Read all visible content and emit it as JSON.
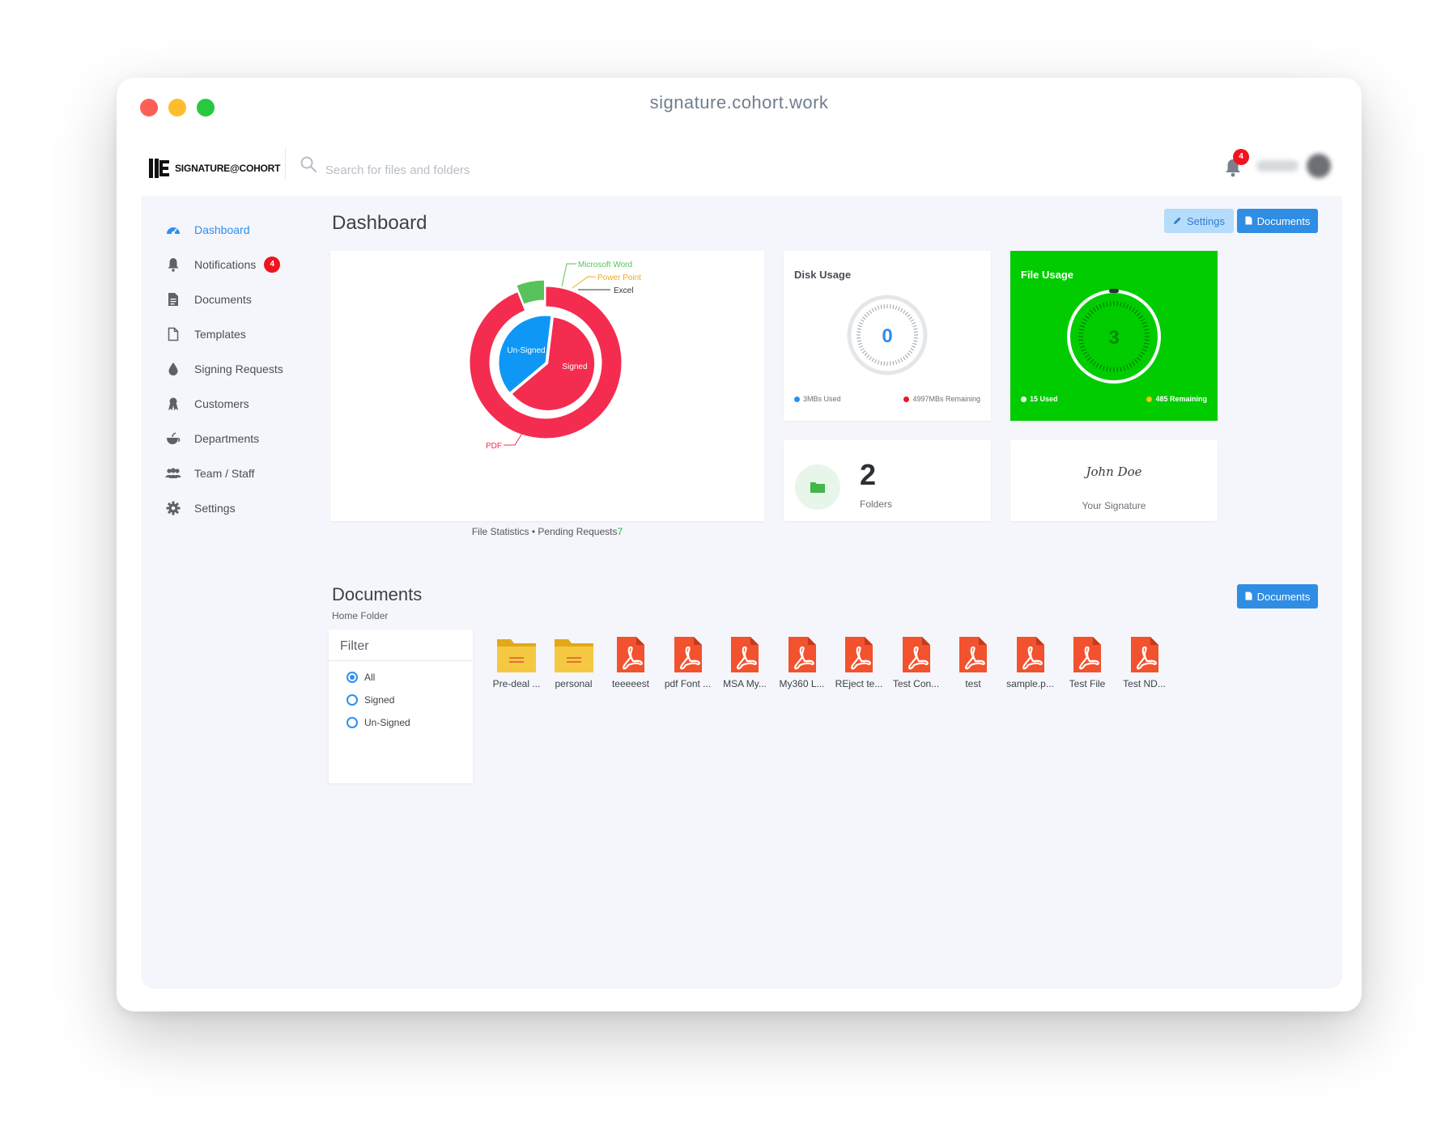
{
  "browser": {
    "url": "signature.cohort.work"
  },
  "brand": {
    "logo_text": "SIGNATURE@COHORT"
  },
  "search": {
    "placeholder": "Search for files and folders"
  },
  "header": {
    "notification_count": "4"
  },
  "sidebar": {
    "items": [
      {
        "label": "Dashboard",
        "icon": "dashboard-icon",
        "active": true
      },
      {
        "label": "Notifications",
        "icon": "bell-icon",
        "badge": "4"
      },
      {
        "label": "Documents",
        "icon": "document-icon"
      },
      {
        "label": "Templates",
        "icon": "template-icon"
      },
      {
        "label": "Signing Requests",
        "icon": "drop-icon"
      },
      {
        "label": "Customers",
        "icon": "customer-icon"
      },
      {
        "label": "Departments",
        "icon": "department-icon"
      },
      {
        "label": "Team / Staff",
        "icon": "team-icon"
      },
      {
        "label": "Settings",
        "icon": "gear-icon"
      }
    ]
  },
  "dashboard": {
    "title": "Dashboard",
    "settings_label": "Settings",
    "documents_label": "Documents"
  },
  "chart_data": {
    "type": "pie",
    "outer_ring": [
      {
        "label": "PDF",
        "value": 94,
        "color": "#f42c50"
      },
      {
        "label": "Microsoft Word",
        "value": 6,
        "color": "#58c35b"
      },
      {
        "label": "Power Point",
        "value": 0,
        "color": "#f5a623"
      },
      {
        "label": "Excel",
        "value": 0,
        "color": "#333333"
      }
    ],
    "inner_pie": [
      {
        "label": "Un-Signed",
        "value": 38,
        "color": "#0f97f5"
      },
      {
        "label": "Signed",
        "value": 62,
        "color": "#f42c50"
      }
    ]
  },
  "file_stats": {
    "caption": "File Statistics • Pending Requests",
    "pending_count": "7"
  },
  "disk_usage": {
    "title": "Disk Usage",
    "value": "0",
    "used": "3MBs Used",
    "remaining": "4997MBs Remaining",
    "used_color": "#2e8ff0",
    "remaining_color": "#f0141e"
  },
  "file_usage": {
    "title": "File Usage",
    "value": "3",
    "used": "15 Used",
    "remaining": "485 Remaining",
    "card_color": "#00cc00",
    "used_color": "#ffffff",
    "remaining_color": "#f5c400"
  },
  "folders": {
    "count": "2",
    "label": "Folders"
  },
  "signature": {
    "name": "John Doe",
    "label": "Your Signature"
  },
  "documents": {
    "title": "Documents",
    "subtitle": "Home Folder",
    "button_label": "Documents",
    "filter_title": "Filter",
    "filter_options": [
      {
        "label": "All",
        "checked": true
      },
      {
        "label": "Signed",
        "checked": false
      },
      {
        "label": "Un-Signed",
        "checked": false
      }
    ],
    "items": [
      {
        "type": "folder",
        "name": "Pre-deal ..."
      },
      {
        "type": "folder",
        "name": "personal"
      },
      {
        "type": "pdf",
        "name": "teeeeest"
      },
      {
        "type": "pdf",
        "name": "pdf Font ..."
      },
      {
        "type": "pdf",
        "name": "MSA My..."
      },
      {
        "type": "pdf",
        "name": "My360 L..."
      },
      {
        "type": "pdf",
        "name": "REject te..."
      },
      {
        "type": "pdf",
        "name": "Test Con..."
      },
      {
        "type": "pdf",
        "name": "test"
      },
      {
        "type": "pdf",
        "name": "sample.p..."
      },
      {
        "type": "pdf",
        "name": "Test File"
      },
      {
        "type": "pdf",
        "name": "Test ND..."
      }
    ]
  }
}
